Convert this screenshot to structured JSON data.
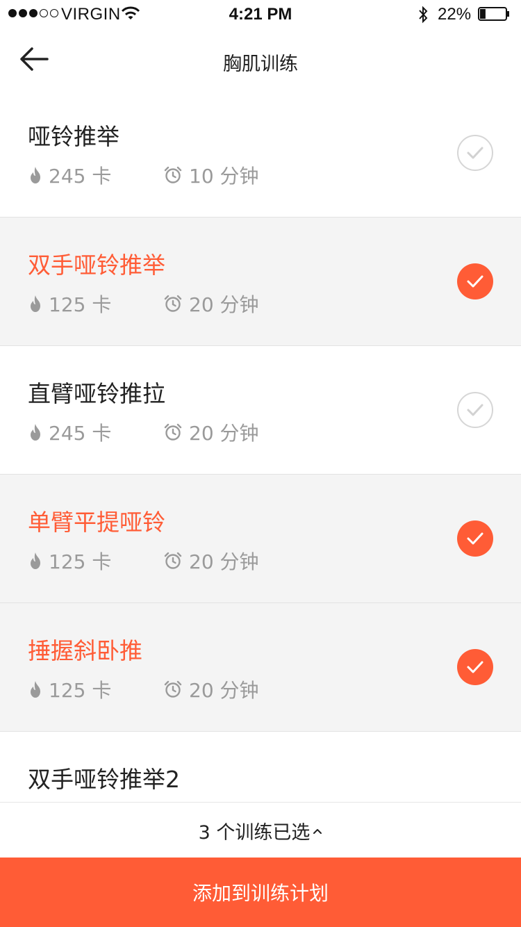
{
  "status_bar": {
    "carrier": "VIRGIN",
    "time": "4:21 PM",
    "battery_percent": "22%",
    "battery_level": 0.22
  },
  "nav": {
    "back_icon": "arrow-left-icon",
    "title": "胸肌训练"
  },
  "colors": {
    "accent": "#ff5c36",
    "muted_text": "#9a9a9a",
    "selected_row_bg": "#f4f4f4"
  },
  "exercises": [
    {
      "name": "哑铃推举",
      "calories": "245 卡",
      "duration": "10 分钟",
      "selected": false
    },
    {
      "name": "双手哑铃推举",
      "calories": "125 卡",
      "duration": "20 分钟",
      "selected": true
    },
    {
      "name": "直臂哑铃推拉",
      "calories": "245 卡",
      "duration": "20 分钟",
      "selected": false
    },
    {
      "name": "单臂平提哑铃",
      "calories": "125 卡",
      "duration": "20 分钟",
      "selected": true
    },
    {
      "name": "捶握斜卧推",
      "calories": "125 卡",
      "duration": "20 分钟",
      "selected": true
    },
    {
      "name": "双手哑铃推举2",
      "calories": "",
      "duration": "",
      "selected": false
    }
  ],
  "footer": {
    "selected_summary": "3 个训练已选",
    "add_button_label": "添加到训练计划"
  }
}
